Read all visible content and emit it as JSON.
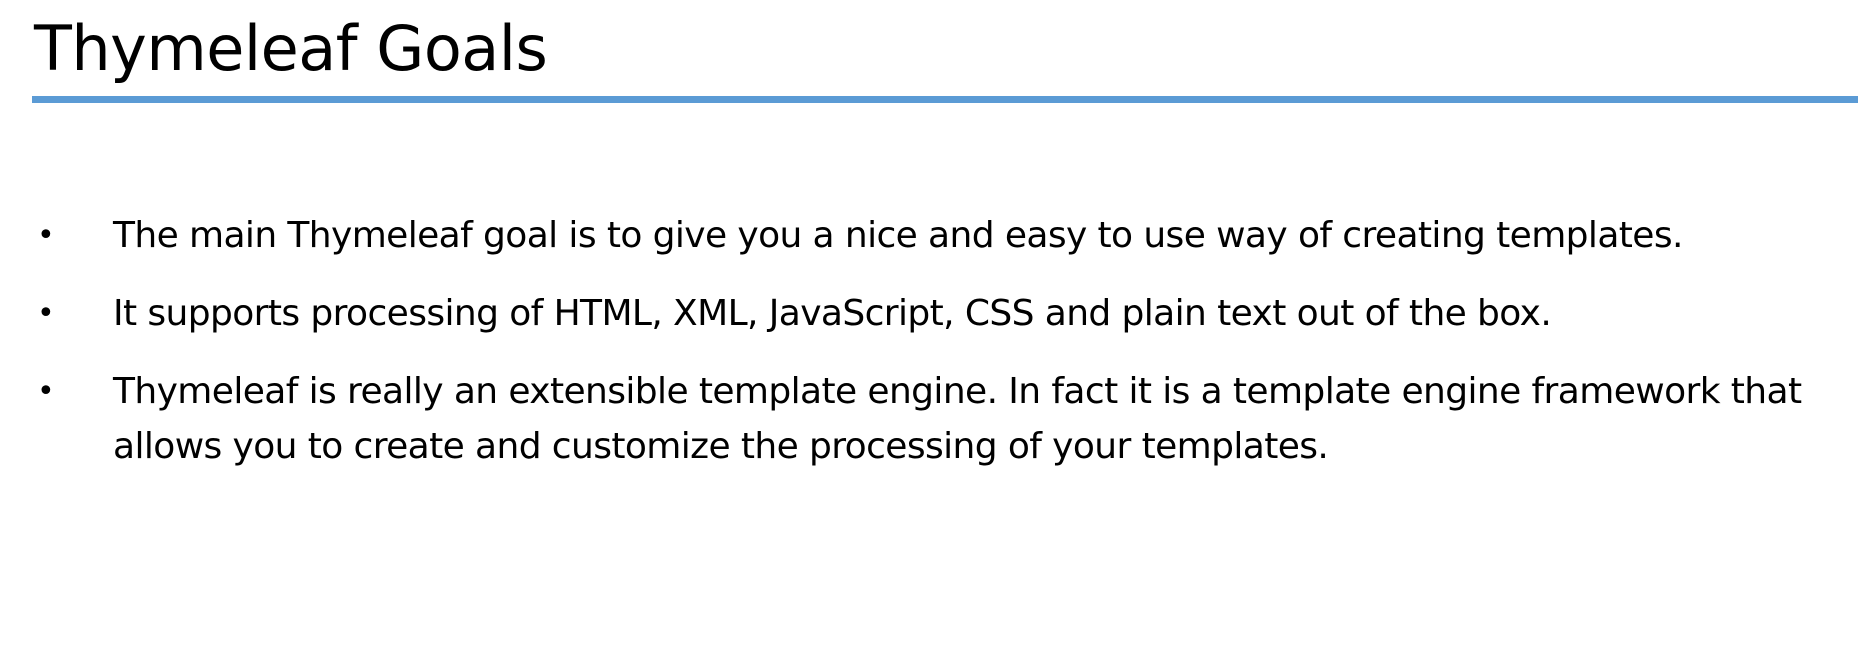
{
  "slide": {
    "title": "Thymeleaf Goals",
    "bullet_symbol": "•",
    "bullets": [
      {
        "text": "The main Thymeleaf goal is to give you a nice and easy to use way of creating templates."
      },
      {
        "text": "It supports processing of HTML, XML, JavaScript, CSS and plain text out of the box."
      },
      {
        "text": "Thymeleaf is really an extensible template engine.  In fact it is a template engine framework that allows you to create and customize the processing of your templates."
      }
    ]
  },
  "colors": {
    "accent_rule": "#5b9bd5",
    "text": "#000000",
    "background": "#ffffff"
  }
}
